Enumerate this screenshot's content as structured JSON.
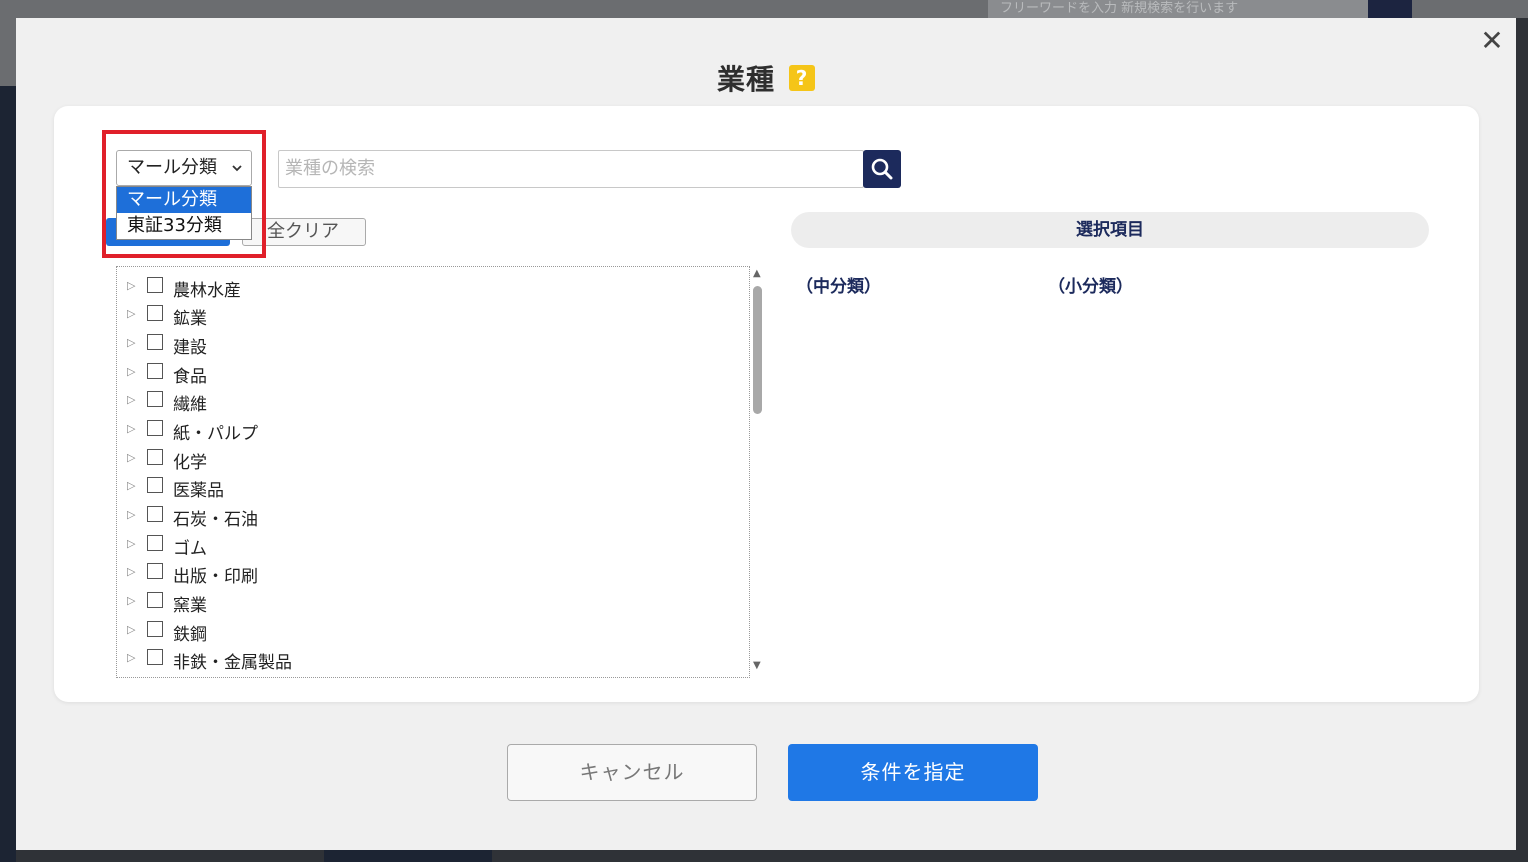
{
  "background": {
    "search_placeholder": "フリーワードを入力 新規検索を行います"
  },
  "modal": {
    "title": "業種",
    "help_glyph": "?",
    "close_glyph": "✕"
  },
  "filter": {
    "select_value": "マール分類",
    "options": [
      "マール分類",
      "東証33分類"
    ],
    "search_placeholder": "業種の検索",
    "clear_button": "全クリア"
  },
  "tree": {
    "items": [
      "農林水産",
      "鉱業",
      "建設",
      "食品",
      "繊維",
      "紙・パルプ",
      "化学",
      "医薬品",
      "石炭・石油",
      "ゴム",
      "出版・印刷",
      "窯業",
      "鉄鋼",
      "非鉄・金属製品"
    ]
  },
  "selected": {
    "header": "選択項目",
    "col_middle": "（中分類）",
    "col_small": "（小分類）"
  },
  "footer": {
    "cancel": "キャンセル",
    "apply": "条件を指定"
  },
  "colors": {
    "accent": "#1f78e6",
    "navy": "#1c2a5c",
    "highlight": "#e0202a",
    "help": "#f5c518"
  }
}
